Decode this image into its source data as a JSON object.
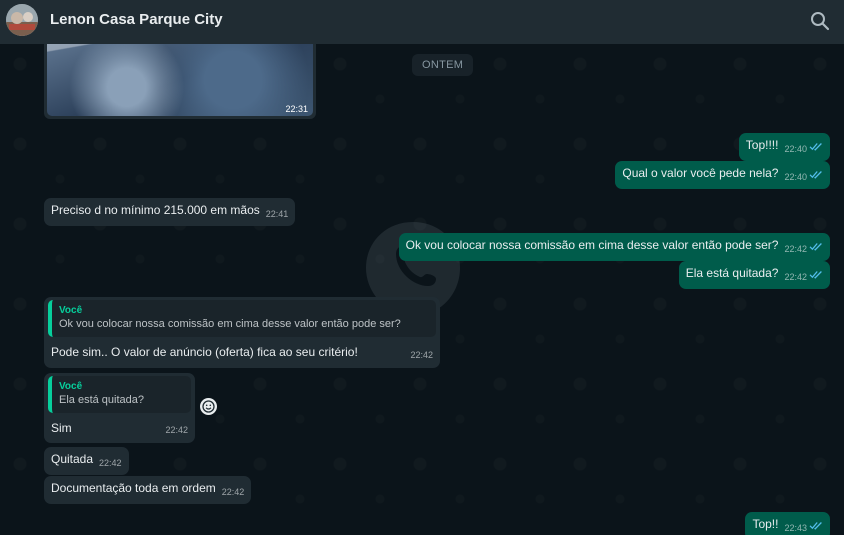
{
  "header": {
    "title": "Lenon Casa Parque City",
    "search_icon": "search-icon",
    "avatar_icon": "avatar"
  },
  "chat": {
    "date_separator": "ONTEM",
    "image_message": {
      "time": "22:31"
    },
    "messages": [
      {
        "direction": "out",
        "text": "Top!!!!",
        "time": "22:40",
        "status": "read"
      },
      {
        "direction": "out",
        "text": "Qual o valor você pede nela?",
        "time": "22:40",
        "status": "read"
      },
      {
        "direction": "in",
        "text": "Preciso d no mínimo 215.000 em mãos",
        "time": "22:41"
      },
      {
        "direction": "out",
        "text": "Ok vou colocar nossa comissão em cima desse valor então pode ser?",
        "time": "22:42",
        "status": "read"
      },
      {
        "direction": "out",
        "text": "Ela está quitada?",
        "time": "22:42",
        "status": "read"
      },
      {
        "direction": "in",
        "quote_author": "Você",
        "quote_text": "Ok vou colocar nossa comissão em cima desse valor então pode ser?",
        "text": "Pode sim.. O valor de anúncio (oferta) fica ao seu critério!",
        "time": "22:42"
      },
      {
        "direction": "in",
        "quote_author": "Você",
        "quote_text": "Ela está quitada?",
        "text": "Sim",
        "time": "22:42"
      },
      {
        "direction": "in",
        "text": "Quitada",
        "time": "22:42"
      },
      {
        "direction": "in",
        "text": "Documentação toda em ordem",
        "time": "22:42"
      },
      {
        "direction": "out",
        "text": "Top!!",
        "time": "22:43",
        "status": "read"
      }
    ]
  },
  "colors": {
    "background": "#0b141a",
    "header": "#202c33",
    "incoming": "#202c33",
    "outgoing": "#005c4b",
    "accent": "#06cf9c",
    "read_ticks": "#53bdeb"
  }
}
